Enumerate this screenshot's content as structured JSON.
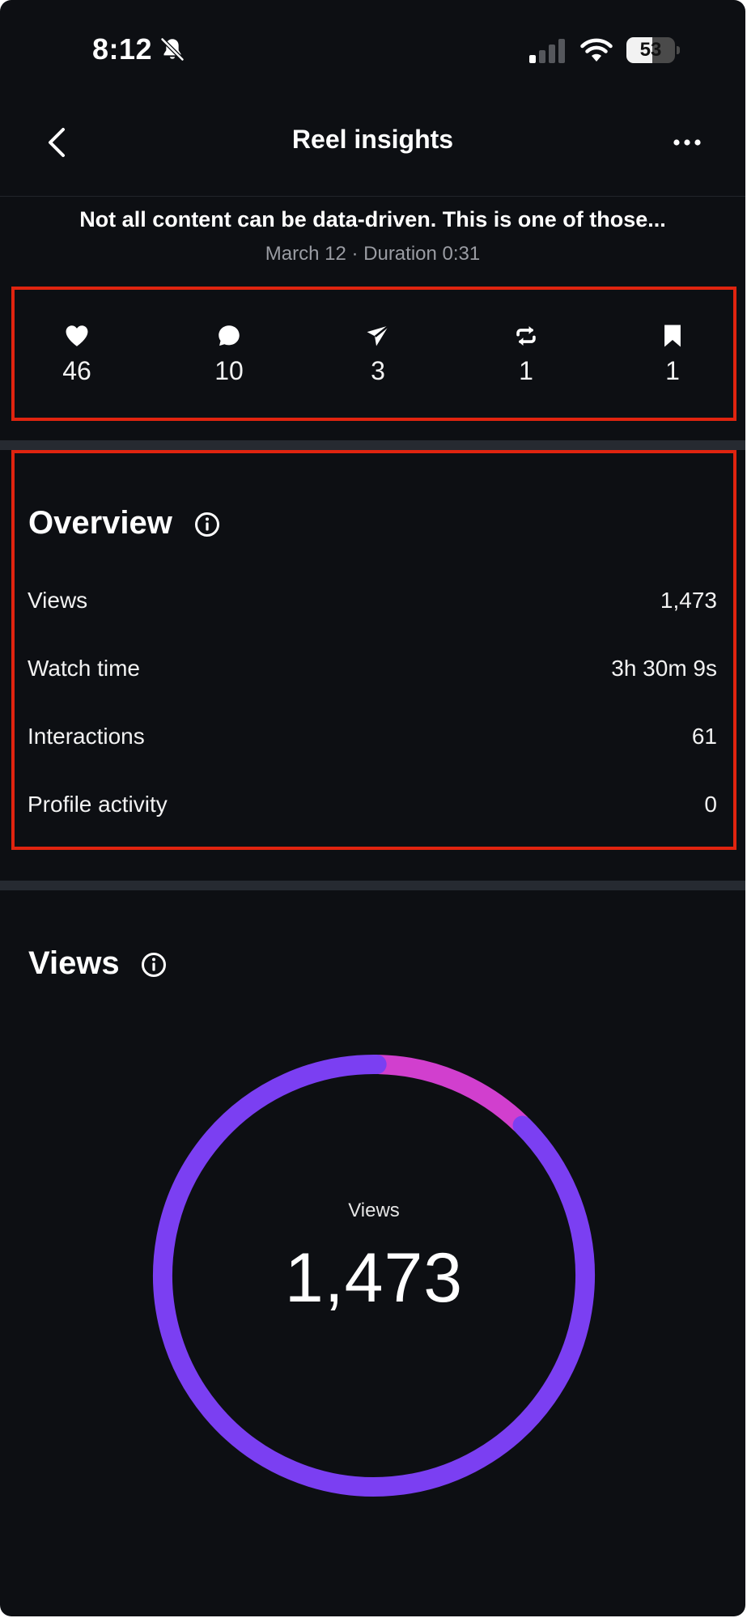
{
  "status_bar": {
    "time": "8:12",
    "battery": "53",
    "battery_level": 0.53
  },
  "nav": {
    "title": "Reel insights"
  },
  "post": {
    "caption": "Not all content can be data-driven. This is one of those...",
    "meta": "March 12 · Duration 0:31"
  },
  "engagement": {
    "likes": "46",
    "comments": "10",
    "shares": "3",
    "reposts": "1",
    "saves": "1"
  },
  "overview": {
    "title": "Overview",
    "rows": [
      {
        "label": "Views",
        "value": "1,473"
      },
      {
        "label": "Watch time",
        "value": "3h 30m 9s"
      },
      {
        "label": "Interactions",
        "value": "61"
      },
      {
        "label": "Profile activity",
        "value": "0"
      }
    ]
  },
  "views": {
    "title": "Views",
    "center_label": "Views",
    "center_value": "1,473"
  },
  "chart_data": {
    "type": "pie",
    "labels": [],
    "values": [
      0.12,
      0.88
    ],
    "colors": [
      "#d13fce",
      "#7b3ff2"
    ]
  }
}
